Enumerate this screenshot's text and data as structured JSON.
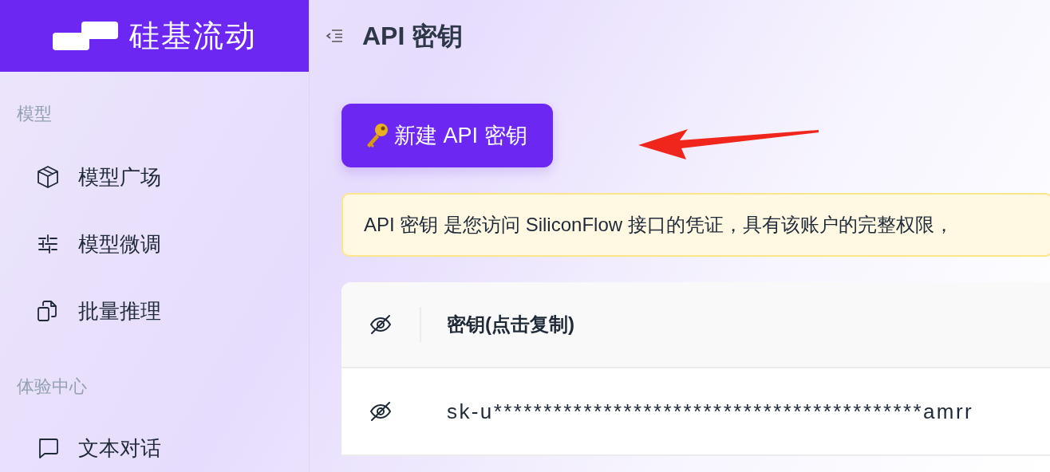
{
  "brand": {
    "name": "硅基流动"
  },
  "page_title": "API 密钥",
  "sidebar": {
    "sections": [
      {
        "heading": "模型",
        "items": [
          {
            "label": "模型广场"
          },
          {
            "label": "模型微调"
          },
          {
            "label": "批量推理"
          }
        ]
      },
      {
        "heading": "体验中心",
        "items": [
          {
            "label": "文本对话"
          }
        ]
      }
    ]
  },
  "new_key_button": {
    "label": "新建 API 密钥"
  },
  "notice": "API 密钥 是您访问 SiliconFlow 接口的凭证，具有该账户的完整权限，",
  "keys_table": {
    "columns": [
      "密钥(点击复制)"
    ],
    "rows": [
      {
        "key": "sk-u*******************************************amrr"
      }
    ]
  }
}
